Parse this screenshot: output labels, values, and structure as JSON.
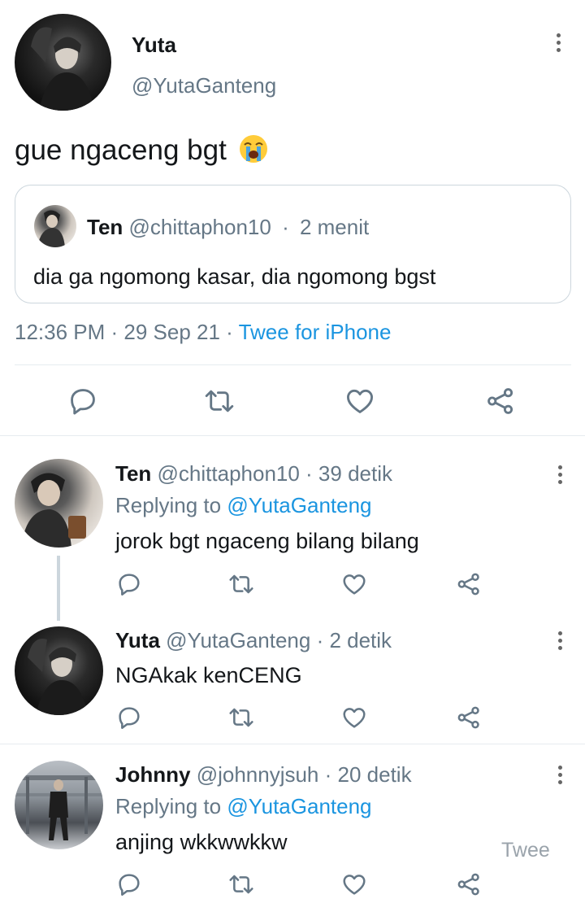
{
  "main_tweet": {
    "author_name": "Yuta",
    "author_handle": "@YutaGanteng",
    "text": "gue ngaceng bgt",
    "emoji": "😭",
    "quote": {
      "author_name": "Ten",
      "author_handle": "@chittaphon10",
      "sep": "·",
      "time": "2 menit",
      "text": "dia ga ngomong kasar, dia ngomong bgst"
    },
    "timestamp": "12:36 PM · 29 Sep 21 · ",
    "source": "Twee for iPhone"
  },
  "replies": [
    {
      "author_name": "Ten",
      "author_handle": "@chittaphon10 · 39 detik",
      "replying_prefix": "Replying to ",
      "replying_to": "@YutaGanteng",
      "text": "jorok bgt ngaceng bilang bilang"
    },
    {
      "author_name": "Yuta",
      "author_handle": "@YutaGanteng · 2 detik",
      "text": "NGAkak kenCENG"
    },
    {
      "author_name": "Johnny",
      "author_handle": "@johnnyjsuh · 20 detik",
      "replying_prefix": "Replying to ",
      "replying_to": "@YutaGanteng",
      "text": "anjing wkkwwkkw"
    }
  ],
  "overlay_label": "Twee",
  "icons": {
    "reply": "reply-icon",
    "retweet": "retweet-icon",
    "like": "heart-icon",
    "share": "share-icon",
    "more": "more-vertical-icon"
  },
  "colors": {
    "accent": "#1b95e0",
    "icon": "#657786",
    "text": "#14171a"
  }
}
